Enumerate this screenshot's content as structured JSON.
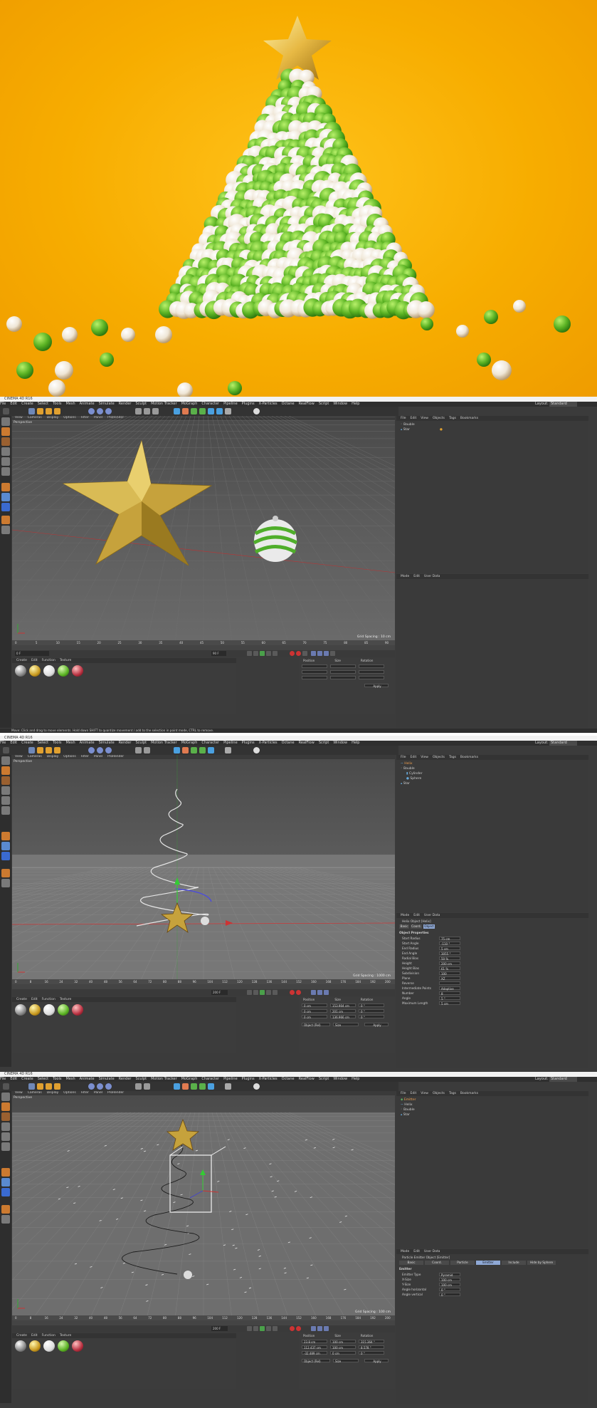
{
  "app_title": "CINEMA 4D R16",
  "menu": [
    "File",
    "Edit",
    "Create",
    "Select",
    "Tools",
    "Mesh",
    "Animate",
    "Simulate",
    "Render",
    "Sculpt",
    "Motion Tracker",
    "MoGraph",
    "Character",
    "Pipeline",
    "Plugins",
    "X-Particles",
    "Octane",
    "RealFlow",
    "Script",
    "Window",
    "Help"
  ],
  "layout_label": "Layout:",
  "layout_value": "Standard",
  "viewport_menu": [
    "View",
    "Cameras",
    "Display",
    "Options",
    "Filter",
    "Panel",
    "ProRender"
  ],
  "viewport_label": "Perspective",
  "om_menu": [
    "File",
    "Edit",
    "View",
    "Objects",
    "Tags",
    "Bookmarks"
  ],
  "am_menu": [
    "Mode",
    "Edit",
    "User Data"
  ],
  "mat_menu": [
    "Create",
    "Edit",
    "Function",
    "Texture"
  ],
  "coord_headers": [
    "Position",
    "Size",
    "Rotation"
  ],
  "apply_label": "Apply",
  "object_rel": "Object (Rel)",
  "size_label": "Size",
  "screen1": {
    "objects": [
      "Bauble",
      "Star"
    ],
    "grid": "Grid Spacing : 10 cm",
    "ruler": [
      "0",
      "5",
      "10",
      "15",
      "20",
      "25",
      "30",
      "35",
      "40",
      "45",
      "50",
      "55",
      "60",
      "65",
      "70",
      "75",
      "80",
      "85",
      "90"
    ],
    "frame_start": "0 F",
    "frame_end": "90 F",
    "materials": [
      "Mat",
      "Mat",
      "Mat",
      "Mat",
      "Mat"
    ],
    "status": "Move: Click and drag to move elements. Hold down SHIFT to quantize movement / add to the selection in point mode, CTRL to remove."
  },
  "screen2": {
    "objects": [
      "Helix",
      "Bauble",
      "Cylinder",
      "Sphere",
      "Star"
    ],
    "grid": "Grid Spacing : 1000 cm",
    "ruler": [
      "0",
      "8",
      "16",
      "24",
      "32",
      "40",
      "48",
      "56",
      "64",
      "72",
      "80",
      "88",
      "96",
      "104",
      "112",
      "120",
      "128",
      "136",
      "144",
      "152",
      "160",
      "168",
      "176",
      "184",
      "192",
      "200"
    ],
    "frame_end": "200 F",
    "attr_title": "Helix Object [Helix]",
    "attr_tabs": [
      "Basic",
      "Coord.",
      "Object"
    ],
    "section": "Object Properties",
    "props": [
      {
        "label": "Start Radius",
        "value": "75 cm"
      },
      {
        "label": "Start Angle",
        "value": "-110 °"
      },
      {
        "label": "End Radius",
        "value": "5 cm"
      },
      {
        "label": "End Angle",
        "value": "3055 °"
      },
      {
        "label": "Radial Bias",
        "value": "50 %"
      },
      {
        "label": "Height",
        "value": "200 cm"
      },
      {
        "label": "Height Bias",
        "value": "61 %"
      },
      {
        "label": "Subdivision",
        "value": "100"
      },
      {
        "label": "Plane",
        "value": "XZ"
      },
      {
        "label": "Reverse",
        "value": ""
      },
      {
        "label": "Intermediate Points",
        "value": "Adaptive"
      },
      {
        "label": "Number",
        "value": "8"
      },
      {
        "label": "Angle",
        "value": "5 °"
      },
      {
        "label": "Maximum Length",
        "value": "5 cm"
      }
    ],
    "coords": [
      {
        "axis": "X",
        "pos": "0 cm",
        "size": "153.904 cm",
        "rot": "0 °"
      },
      {
        "axis": "Y",
        "pos": "0 cm",
        "size": "201 cm",
        "rot": "0 °"
      },
      {
        "axis": "Z",
        "pos": "0 cm",
        "size": "136.966 cm",
        "rot": "0 °"
      }
    ]
  },
  "screen3": {
    "objects": [
      "Emitter",
      "Helix",
      "Bauble",
      "Star"
    ],
    "grid": "Grid Spacing : 100 cm",
    "ruler": [
      "0",
      "8",
      "16",
      "24",
      "32",
      "40",
      "48",
      "56",
      "64",
      "72",
      "80",
      "88",
      "96",
      "104",
      "112",
      "120",
      "128",
      "136",
      "144",
      "152",
      "160",
      "168",
      "176",
      "184",
      "192",
      "200"
    ],
    "frame_end": "200 F",
    "attr_title": "Particle Emitter Object [Emitter]",
    "attr_tabs": [
      "Basic",
      "Coord.",
      "Particle",
      "Emitter",
      "Include",
      "Hide by Sphere"
    ],
    "section": "Emitter",
    "props": [
      {
        "label": "Emitter Type",
        "value": "Pyramid"
      },
      {
        "label": "X-Size",
        "value": "100 cm"
      },
      {
        "label": "Y-Size",
        "value": "100 cm"
      },
      {
        "label": "Angle horizontal",
        "value": "0 °"
      },
      {
        "label": "Angle vertical",
        "value": "0 °"
      }
    ],
    "coords": [
      {
        "axis": "X",
        "pos": "23.8 cm",
        "size": "100 cm",
        "rot": "315.364 °"
      },
      {
        "axis": "Y",
        "pos": "112.437 cm",
        "size": "100 cm",
        "rot": "8.578 °"
      },
      {
        "axis": "Z",
        "pos": "-32.489 cm",
        "size": "0 cm",
        "rot": "0 °"
      }
    ]
  },
  "colors": {
    "accent": "#8fa9d6",
    "hero_bg": "#f7ad00",
    "ui_bg": "#3b3b3b"
  }
}
